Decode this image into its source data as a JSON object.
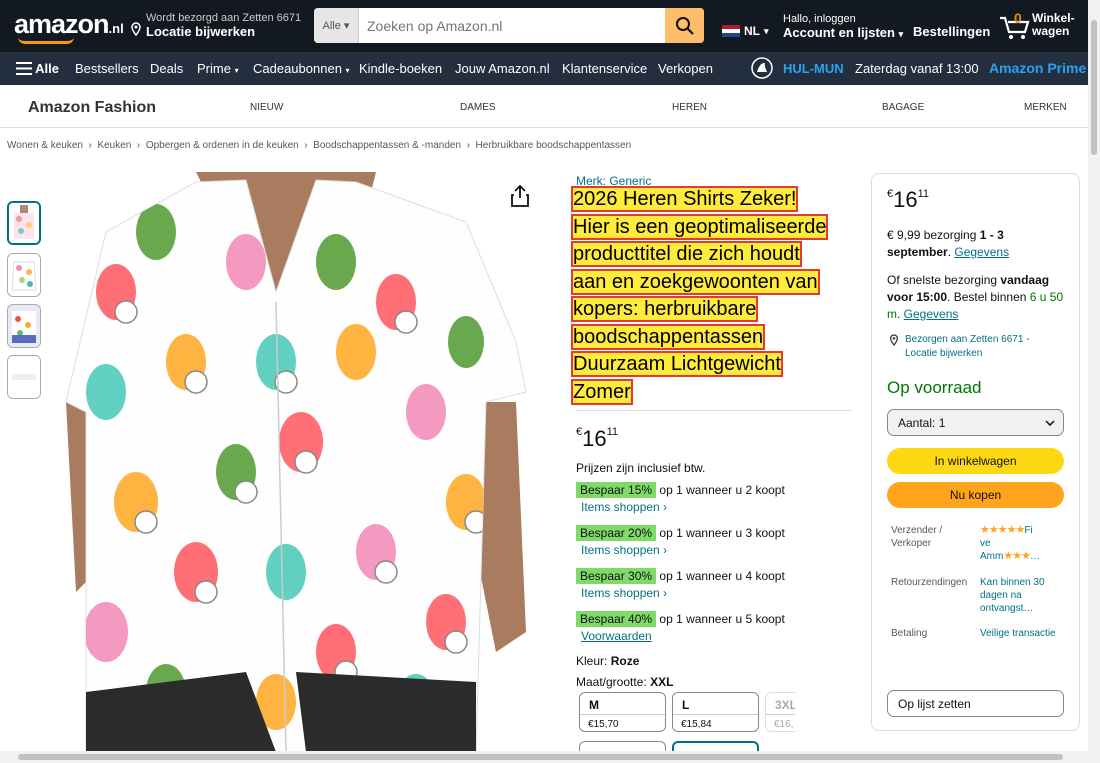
{
  "header": {
    "logo": "amazon",
    "logo_tld": ".nl",
    "deliver_line1": "Wordt bezorgd aan Zetten 6671",
    "deliver_line2": "Locatie bijwerken",
    "search_category": "Alle",
    "search_placeholder": "Zoeken op Amazon.nl",
    "language": "NL",
    "account_line1": "Hallo, inloggen",
    "account_line2": "Account en lijsten",
    "orders": "Bestellingen",
    "cart_count": "0",
    "cart_label_1": "Winkel-",
    "cart_label_2": "wagen"
  },
  "nav": {
    "all": "Alle",
    "items": [
      "Bestsellers",
      "Deals",
      "Prime",
      "Cadeaubonnen",
      "Kindle-boeken",
      "Jouw Amazon.nl",
      "Klantenservice",
      "Verkopen"
    ],
    "match": "HUL-MUN",
    "match_time": "Zaterdag vanaf 13:00",
    "prime": "Amazon Prime"
  },
  "fashion_nav": {
    "brand": "Amazon Fashion",
    "items": [
      "NIEUW",
      "DAMES",
      "HEREN",
      "BAGAGE",
      "MERKEN"
    ]
  },
  "breadcrumb": [
    "Wonen & keuken",
    "Keuken",
    "Opbergen & ordenen in de keuken",
    "Boodschappentassen & -manden",
    "Herbruikbare boodschappentassen"
  ],
  "product": {
    "brand": "Merk: Generic",
    "title_lines": [
      "2026 Heren Shirts Zeker!",
      "Hier is een geoptimaliseerde",
      "producttitel die zich houdt",
      "aan en zoekgewoonten van",
      "kopers: herbruikbare",
      "boodschappentassen",
      "Duurzaam Lichtgewicht",
      "Zomer"
    ],
    "currency": "€",
    "price_whole": "16",
    "price_fraction": "11",
    "vat_note": "Prijzen zijn inclusief btw.",
    "savings": [
      {
        "tag": "Bespaar 15%",
        "text": "op 1 wanneer u 2 koopt",
        "link": "Items shoppen ›"
      },
      {
        "tag": "Bespaar 20%",
        "text": "op 1 wanneer u 3 koopt",
        "link": "Items shoppen ›"
      },
      {
        "tag": "Bespaar 30%",
        "text": "op 1 wanneer u 4 koopt",
        "link": "Items shoppen ›"
      },
      {
        "tag": "Bespaar 40%",
        "text": "op 1 wanneer u 5 koopt",
        "link": "Voorwaarden"
      }
    ],
    "color_label": "Kleur:",
    "color_value": "Roze",
    "size_label": "Maat/grootte:",
    "size_value": "XXL",
    "sizes": [
      {
        "name": "M",
        "price": "€15,70"
      },
      {
        "name": "L",
        "price": "€15,84"
      },
      {
        "name": "3XL",
        "price": "€16,…"
      }
    ]
  },
  "buybox": {
    "currency": "€",
    "price_whole": "16",
    "price_fraction": "11",
    "delivery_1": "€ 9,99 bezorging ",
    "delivery_1_bold": "1 - 3 september",
    "delivery_link": "Gegevens",
    "fastest_1": "Of snelste bezorging ",
    "fastest_bold": "vandaag voor 15:00",
    "fastest_2": ". Bestel binnen ",
    "fastest_green": "6 u 50 m",
    "deliver_to": "Bezorgen aan Zetten 6671 - Locatie bijwerken",
    "stock": "Op voorraad",
    "qty": "Aantal:  1",
    "add_to_cart": "In winkelwagen",
    "buy_now": "Nu kopen",
    "shipper_label": "Verzender / Verkoper",
    "shipper_value_1": "Fi",
    "shipper_value_2": "ve",
    "shipper_value_3": "Amm",
    "returns_label": "Retourzendingen",
    "returns_value": "Kan binnen 30 dagen na ontvangst…",
    "payment_label": "Betaling",
    "payment_value": "Veilige transactie",
    "add_to_list": "Op lijst zetten"
  }
}
